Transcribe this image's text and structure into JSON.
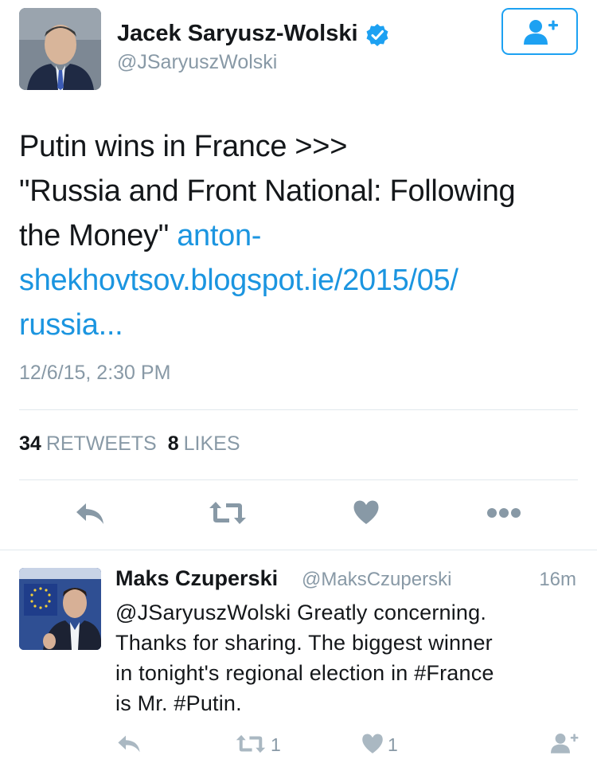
{
  "tweet": {
    "author_name": "Jacek Saryusz-Wolski",
    "author_handle": "@JSaryuszWolski",
    "text_line1": "Putin wins in France >>>",
    "text_line2": "\"Russia and Front National: Following",
    "text_line3_plain": "the Money\" ",
    "link_part1": "anton-",
    "link_part2": "shekhovtsov.blogspot.ie/2015/05/",
    "link_part3": "russia...",
    "timestamp": "12/6/15, 2:30 PM",
    "retweets_count": "34",
    "retweets_label": "RETWEETS",
    "likes_count": "8",
    "likes_label": "LIKES"
  },
  "reply": {
    "author_name": "Maks Czuperski",
    "author_handle": "@MaksCzuperski",
    "time": "16m",
    "text_line1": "@JSaryuszWolski Greatly concerning.",
    "text_line2": "Thanks for sharing. The biggest winner",
    "text_line3": "in tonight's regional election in #France",
    "text_line4": "is Mr. #Putin.",
    "retweet_count": "1",
    "like_count": "1"
  },
  "colors": {
    "accent": "#1da1f2",
    "link": "#1b95e0",
    "muted": "#8899a6",
    "icon": "#8899a6",
    "divider": "#e1e8ed"
  },
  "icons": [
    "verified-badge-icon",
    "follow-person-plus-icon",
    "reply-icon",
    "retweet-icon",
    "like-heart-icon",
    "more-dots-icon"
  ]
}
